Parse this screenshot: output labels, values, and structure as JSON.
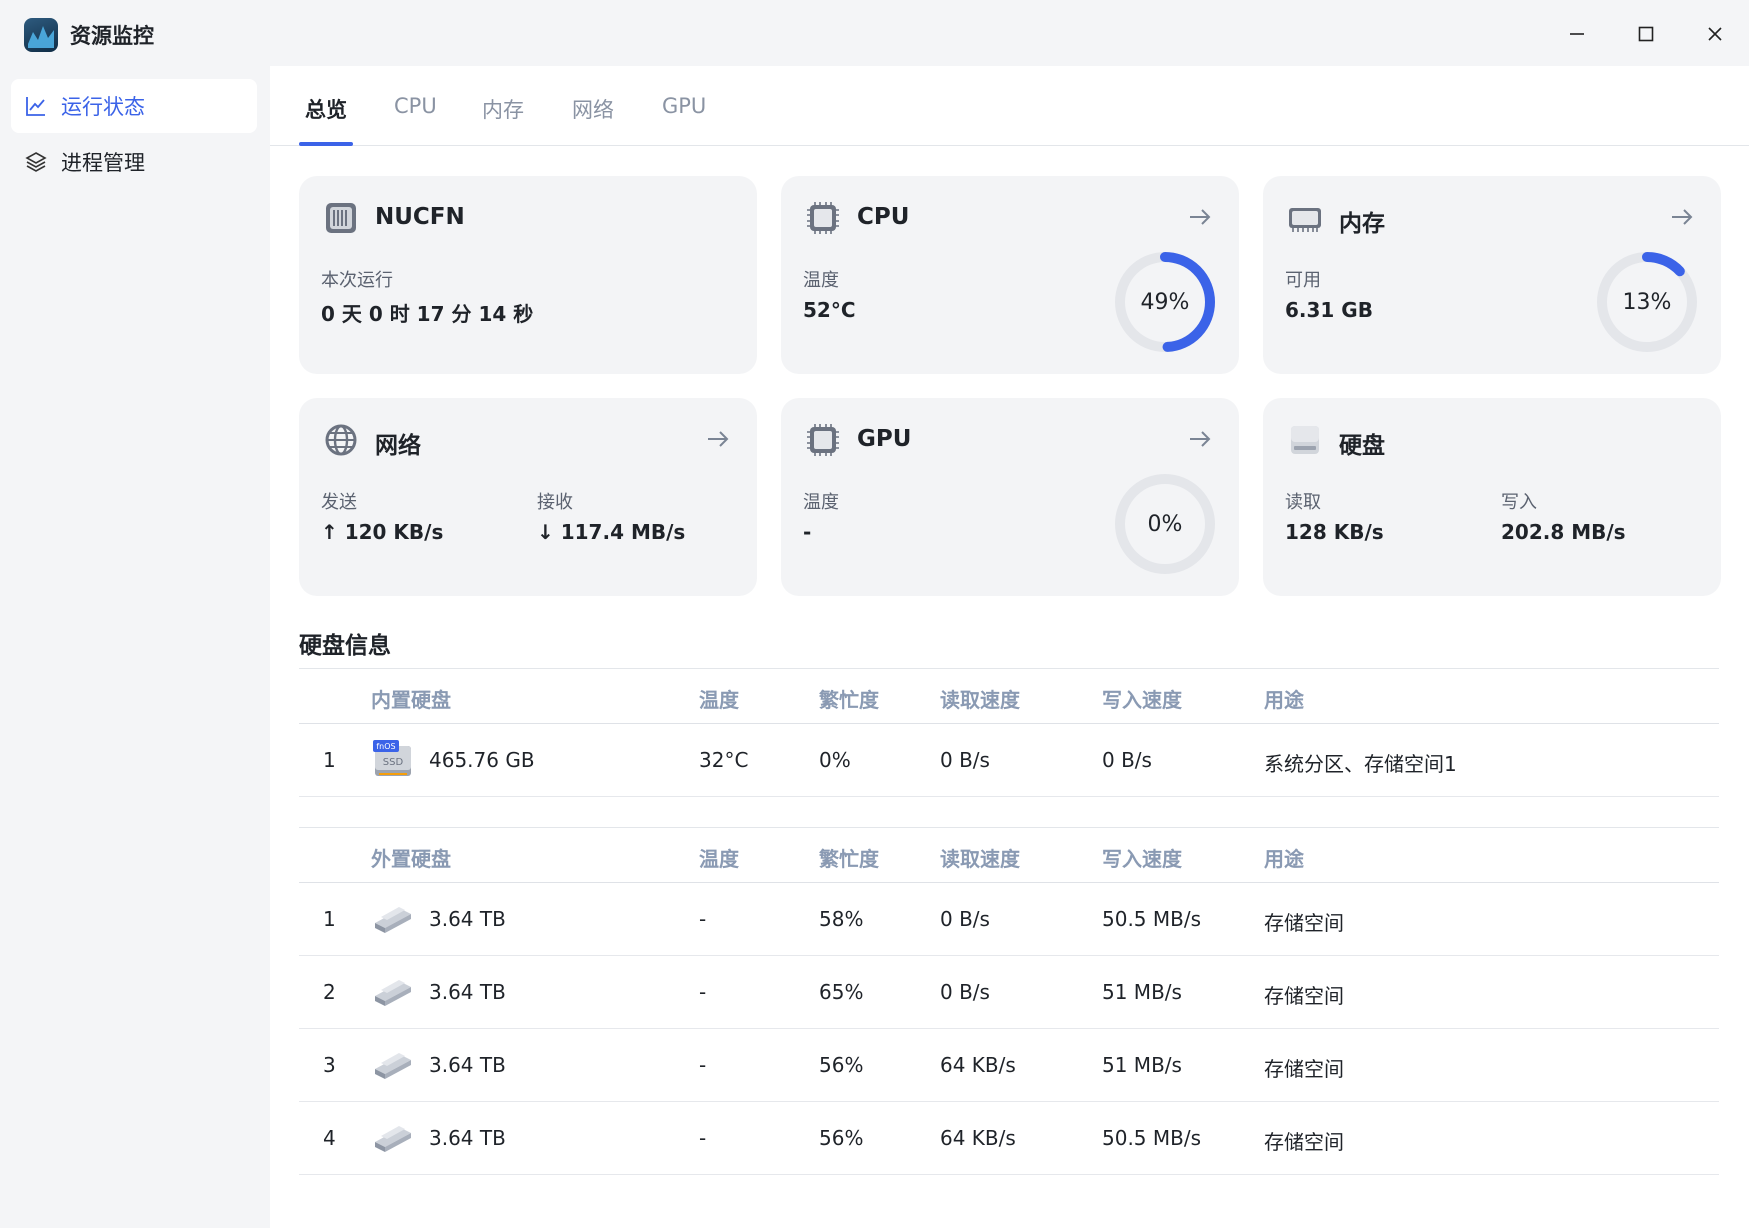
{
  "app": {
    "title": "资源监控",
    "accent": "#3b63e8"
  },
  "sidebar": {
    "items": [
      {
        "label": "运行状态",
        "icon": "chart-line-icon",
        "active": true
      },
      {
        "label": "进程管理",
        "icon": "layers-icon",
        "active": false
      }
    ]
  },
  "tabs": [
    {
      "label": "总览",
      "active": true
    },
    {
      "label": "CPU"
    },
    {
      "label": "内存"
    },
    {
      "label": "网络"
    },
    {
      "label": "GPU"
    }
  ],
  "cards": {
    "host": {
      "title": "NUCFN",
      "label": "本次运行",
      "value": "0 天 0 时 17 分 14 秒"
    },
    "cpu": {
      "title": "CPU",
      "label": "温度",
      "value": "52°C",
      "usage_text": "49%",
      "usage": 0.49
    },
    "memory": {
      "title": "内存",
      "label": "可用",
      "value": "6.31 GB",
      "usage_text": "13%",
      "usage": 0.13
    },
    "network": {
      "title": "网络",
      "send_label": "发送",
      "send_value": "↑ 120 KB/s",
      "recv_label": "接收",
      "recv_value": "↓ 117.4 MB/s"
    },
    "gpu": {
      "title": "GPU",
      "label": "温度",
      "value": "-",
      "usage_text": "0%",
      "usage": 0
    },
    "disk": {
      "title": "硬盘",
      "read_label": "读取",
      "read_value": "128 KB/s",
      "write_label": "写入",
      "write_value": "202.8 MB/s"
    }
  },
  "disk_info": {
    "title": "硬盘信息",
    "internal": {
      "headers": [
        "内置硬盘",
        "温度",
        "繁忙度",
        "读取速度",
        "写入速度",
        "用途"
      ],
      "icon_badge": "fnOS",
      "icon_text": "SSD",
      "rows": [
        {
          "index": "1",
          "size": "465.76 GB",
          "temp": "32°C",
          "busy": "0%",
          "read": "0 B/s",
          "write": "0 B/s",
          "usage": "系统分区、存储空间1"
        }
      ]
    },
    "external": {
      "headers": [
        "外置硬盘",
        "温度",
        "繁忙度",
        "读取速度",
        "写入速度",
        "用途"
      ],
      "rows": [
        {
          "index": "1",
          "size": "3.64 TB",
          "temp": "-",
          "busy": "58%",
          "read": "0 B/s",
          "write": "50.5 MB/s",
          "usage": "存储空间"
        },
        {
          "index": "2",
          "size": "3.64 TB",
          "temp": "-",
          "busy": "65%",
          "read": "0 B/s",
          "write": "51 MB/s",
          "usage": "存储空间"
        },
        {
          "index": "3",
          "size": "3.64 TB",
          "temp": "-",
          "busy": "56%",
          "read": "64 KB/s",
          "write": "51 MB/s",
          "usage": "存储空间"
        },
        {
          "index": "4",
          "size": "3.64 TB",
          "temp": "-",
          "busy": "56%",
          "read": "64 KB/s",
          "write": "50.5 MB/s",
          "usage": "存储空间"
        }
      ]
    }
  }
}
